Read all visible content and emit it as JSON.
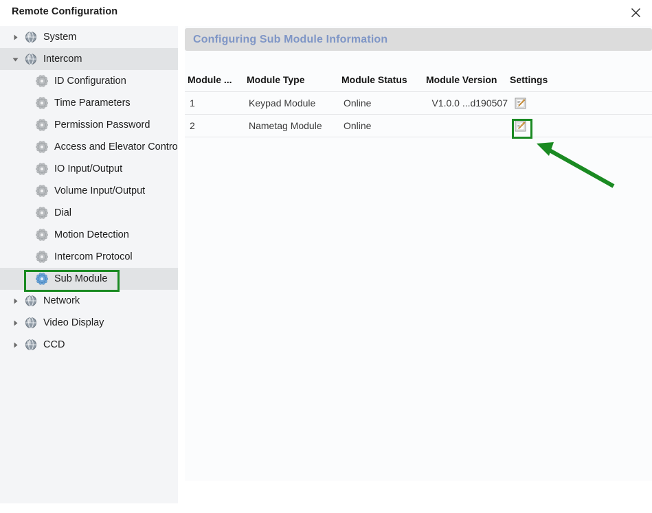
{
  "window": {
    "title": "Remote Configuration",
    "close_icon": "close-icon"
  },
  "sidebar": {
    "items": [
      {
        "label": "System",
        "level": 0,
        "expanded": false,
        "selected": false,
        "icon": "globe-icon"
      },
      {
        "label": "Intercom",
        "level": 0,
        "expanded": true,
        "selected": true,
        "icon": "globe-icon"
      },
      {
        "label": "ID Configuration",
        "level": 1,
        "expanded": null,
        "selected": false,
        "icon": "gear-icon"
      },
      {
        "label": "Time Parameters",
        "level": 1,
        "expanded": null,
        "selected": false,
        "icon": "gear-icon"
      },
      {
        "label": "Permission Password",
        "level": 1,
        "expanded": null,
        "selected": false,
        "icon": "gear-icon"
      },
      {
        "label": "Access and Elevator Control",
        "level": 1,
        "expanded": null,
        "selected": false,
        "icon": "gear-icon"
      },
      {
        "label": "IO Input/Output",
        "level": 1,
        "expanded": null,
        "selected": false,
        "icon": "gear-icon"
      },
      {
        "label": "Volume Input/Output",
        "level": 1,
        "expanded": null,
        "selected": false,
        "icon": "gear-icon"
      },
      {
        "label": "Dial",
        "level": 1,
        "expanded": null,
        "selected": false,
        "icon": "gear-icon"
      },
      {
        "label": "Motion Detection",
        "level": 1,
        "expanded": null,
        "selected": false,
        "icon": "gear-icon"
      },
      {
        "label": "Intercom Protocol",
        "level": 1,
        "expanded": null,
        "selected": false,
        "icon": "gear-icon"
      },
      {
        "label": "Sub Module",
        "level": 1,
        "expanded": null,
        "selected": true,
        "icon": "gear-icon-active"
      },
      {
        "label": "Network",
        "level": 0,
        "expanded": false,
        "selected": false,
        "icon": "globe-icon"
      },
      {
        "label": "Video Display",
        "level": 0,
        "expanded": false,
        "selected": false,
        "icon": "globe-icon"
      },
      {
        "label": "CCD",
        "level": 0,
        "expanded": false,
        "selected": false,
        "icon": "globe-icon"
      }
    ]
  },
  "main": {
    "panel_title": "Configuring Sub Module Information",
    "table": {
      "columns": [
        "Module ...",
        "Module Type",
        "Module Status",
        "Module Version",
        "Settings"
      ],
      "rows": [
        {
          "module_id": "1",
          "module_type": "Keypad Module",
          "module_status": "Online",
          "module_version": "V1.0.0 ...d190507",
          "settings_icon": "edit-pencil-icon"
        },
        {
          "module_id": "2",
          "module_type": "Nametag Module",
          "module_status": "Online",
          "module_version": "",
          "settings_icon": "edit-pencil-icon"
        }
      ]
    }
  },
  "annotations": {
    "highlight_color": "#1a8a22",
    "highlighted_sidebar_item": "Sub Module",
    "highlighted_cell": "Settings edit icon of row 2",
    "arrow": "green-arrow-pointing-to-edit-icon"
  },
  "colors": {
    "panel_header_bg": "#dcdcdc",
    "panel_header_text": "#7f96c6",
    "sidebar_bg": "#f4f5f7",
    "sidebar_selected_bg": "#e1e3e5",
    "content_bg": "#fbfcfd"
  }
}
